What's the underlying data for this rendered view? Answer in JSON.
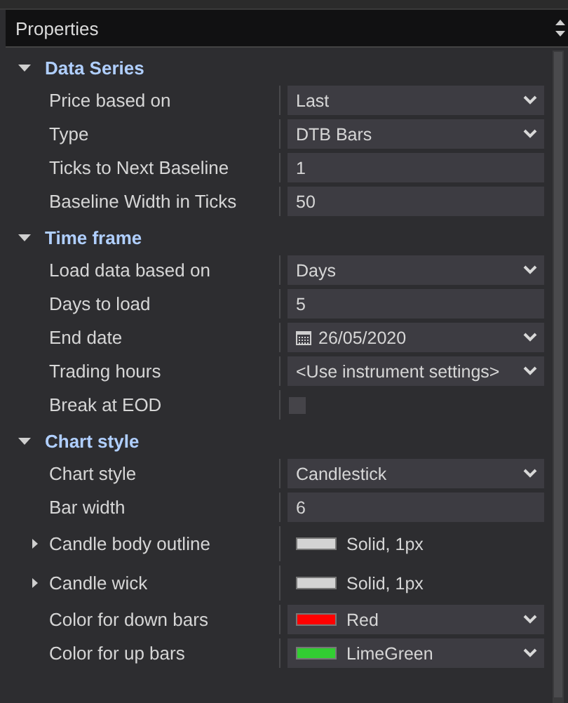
{
  "panel": {
    "title": "Properties"
  },
  "sections": [
    {
      "title": "Data Series",
      "expanded": true,
      "rows": [
        {
          "kind": "dropdown",
          "label": "Price based on",
          "value": "Last"
        },
        {
          "kind": "dropdown",
          "label": "Type",
          "value": "DTB Bars"
        },
        {
          "kind": "input",
          "label": "Ticks to Next Baseline",
          "value": "1"
        },
        {
          "kind": "input",
          "label": "Baseline Width in Ticks",
          "value": "50"
        }
      ]
    },
    {
      "title": "Time frame",
      "expanded": true,
      "rows": [
        {
          "kind": "dropdown",
          "label": "Load data based on",
          "value": "Days"
        },
        {
          "kind": "input",
          "label": "Days to load",
          "value": "5"
        },
        {
          "kind": "date",
          "label": "End date",
          "value": "26/05/2020"
        },
        {
          "kind": "dropdown",
          "label": "Trading hours",
          "value": "<Use instrument settings>"
        },
        {
          "kind": "checkbox",
          "label": "Break at EOD",
          "checked": false
        }
      ]
    },
    {
      "title": "Chart style",
      "expanded": true,
      "rows": [
        {
          "kind": "dropdown",
          "label": "Chart style",
          "value": "Candlestick"
        },
        {
          "kind": "input",
          "label": "Bar width",
          "value": "6"
        },
        {
          "kind": "stroke",
          "label": "Candle body outline",
          "value": "Solid, 1px",
          "color": "#d3d3d3",
          "expanded": false
        },
        {
          "kind": "stroke",
          "label": "Candle wick",
          "value": "Solid, 1px",
          "color": "#d3d3d3",
          "expanded": false
        },
        {
          "kind": "color",
          "label": "Color for down bars",
          "value": "Red",
          "color": "#ff0000"
        },
        {
          "kind": "color",
          "label": "Color for up bars",
          "value": "LimeGreen",
          "color": "#32cd32"
        }
      ]
    }
  ]
}
